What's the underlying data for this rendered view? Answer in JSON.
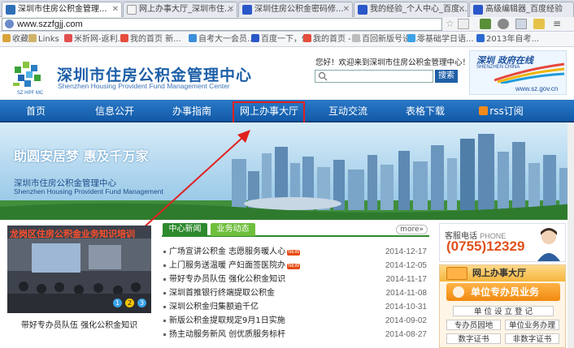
{
  "tabs": [
    {
      "label": "深圳市住房公积金管理...",
      "active": true
    },
    {
      "label": "网上办事大厅_深圳市住...",
      "active": false
    },
    {
      "label": "深圳住房公积金密码修...",
      "active": false
    },
    {
      "label": "我的经验_个人中心_百度...",
      "active": false
    },
    {
      "label": "高级编辑器_百度经验",
      "active": false
    }
  ],
  "address": {
    "url": "www.szzfgjj.com"
  },
  "bookmarks": [
    "收藏",
    "Links",
    "米折网-返利...",
    "我的首页 新...",
    "自考大一会员...",
    "百度一下，你...",
    "我的首页 - ...",
    "百回新版号设...",
    "零基础学日语...",
    "2013年自考..."
  ],
  "header": {
    "title": "深圳市住房公积金管理中心",
    "subtitle": "Shenzhen Housing Provident Fund Management Center",
    "logo_text": "SZ HPF MC",
    "welcome": "您好！欢迎来到深圳市住房公积金管理中心！",
    "search_button": "搜索",
    "right_banner_cn": "深圳 政府在线",
    "right_banner_en": "SHENZHEN CHINA",
    "right_banner_url": "www.sz.gov.cn"
  },
  "nav": [
    "首页",
    "信息公开",
    "办事指南",
    "网上办事大厅",
    "互动交流",
    "表格下载",
    "rss订阅"
  ],
  "hero": {
    "slogan": "助圆安居梦 惠及千万家",
    "org_cn": "深圳市住房公积金管理中心",
    "org_en": "Shenzhen Housing Provident Fund Management"
  },
  "left_news": {
    "image_caption": "龙岗区住房公积金业务知识培训",
    "caption": "带好专办员队伍 强化公积金知识",
    "pager": [
      "1",
      "2",
      "3"
    ]
  },
  "news_tabs": {
    "tab1": "中心新闻",
    "tab2": "业务动态",
    "more": "more»"
  },
  "news": [
    {
      "title": "广场宣讲公积金 志愿服务暖人心",
      "new": true,
      "date": "2014-12-17"
    },
    {
      "title": "上门服务送温暖 产妇面签医院办",
      "new": true,
      "date": "2014-12-05"
    },
    {
      "title": "带好专办员队伍 强化公积金知识",
      "new": false,
      "date": "2014-11-17"
    },
    {
      "title": "深圳首推银行终端提取公积金",
      "new": false,
      "date": "2014-11-08"
    },
    {
      "title": "深圳公积金归集额逾千亿",
      "new": false,
      "date": "2014-10-31"
    },
    {
      "title": "新版公积金提取规定9月1日实施",
      "new": false,
      "date": "2014-09-02"
    },
    {
      "title": "扬主动服务新风 创优质服务标杆",
      "new": false,
      "date": "2014-08-27"
    }
  ],
  "new_badge": "NEW",
  "hotline": {
    "label": "客服电话",
    "label_en": "PHONE",
    "number": "(0755)12329"
  },
  "hall": {
    "title": "网上办事大厅",
    "button": "单位专办员业务",
    "links": [
      "单 位 设 立 登 记",
      "专办员园地",
      "单位业务办理",
      "数字证书",
      "非数字证书"
    ]
  }
}
